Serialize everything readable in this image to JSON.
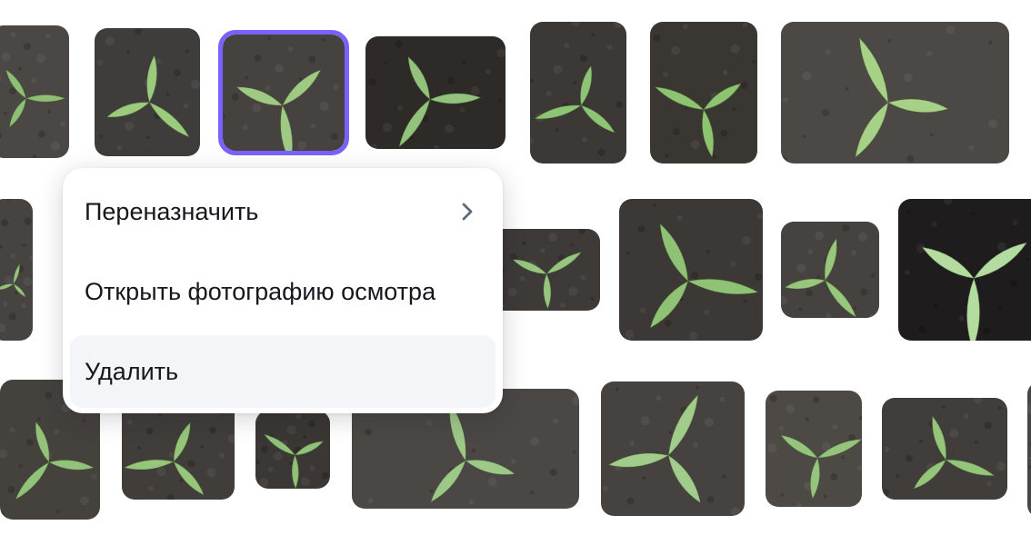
{
  "thumbnails": [
    {
      "name": "seedling-photo",
      "bg": "#4a4744",
      "leaf": "#8fbf74",
      "selected": false
    },
    {
      "name": "seedling-photo",
      "bg": "#3f3d3b",
      "leaf": "#9ccb7d",
      "selected": false
    },
    {
      "name": "seedling-photo",
      "bg": "#46423f",
      "leaf": "#a0c983",
      "selected": true
    },
    {
      "name": "seedling-photo",
      "bg": "#2e2a27",
      "leaf": "#92c27b",
      "selected": false
    },
    {
      "name": "seedling-photo",
      "bg": "#3b3836",
      "leaf": "#8ec476",
      "selected": false
    },
    {
      "name": "seedling-photo",
      "bg": "#3a3733",
      "leaf": "#8cc470",
      "selected": false
    },
    {
      "name": "seedling-photo",
      "bg": "#4c4845",
      "leaf": "#a6d187",
      "selected": false
    },
    {
      "name": "seedling-photo",
      "bg": "#464341",
      "leaf": "#96c27e",
      "selected": false
    },
    {
      "name": "seedling-photo",
      "bg": "#3d3a37",
      "leaf": "#97c47f",
      "selected": false
    },
    {
      "name": "seedling-photo",
      "bg": "#3b3835",
      "leaf": "#8fc275",
      "selected": false
    },
    {
      "name": "seedling-photo",
      "bg": "#46423f",
      "leaf": "#98c67d",
      "selected": false
    },
    {
      "name": "seedling-photo",
      "bg": "#1e1c1d",
      "leaf": "#b4dba0",
      "selected": false
    },
    {
      "name": "seedling-photo",
      "bg": "#45413d",
      "leaf": "#93c27a",
      "selected": false
    },
    {
      "name": "seedling-photo",
      "bg": "#403d3a",
      "leaf": "#95c67a",
      "selected": false
    },
    {
      "name": "seedling-photo",
      "bg": "#3a3734",
      "leaf": "#8fc176",
      "selected": false
    },
    {
      "name": "seedling-photo",
      "bg": "#4a4744",
      "leaf": "#9ec887",
      "selected": false
    },
    {
      "name": "seedling-photo",
      "bg": "#46423f",
      "leaf": "#a2cc8b",
      "selected": false
    },
    {
      "name": "seedling-photo",
      "bg": "#4d4945",
      "leaf": "#96c37d",
      "selected": false
    },
    {
      "name": "seedling-photo",
      "bg": "#403d3a",
      "leaf": "#94c57b",
      "selected": false
    },
    {
      "name": "seedling-photo",
      "bg": "#484542",
      "leaf": "#9bc985",
      "selected": false
    }
  ],
  "context_menu": {
    "items": [
      {
        "label": "Переназначить",
        "has_submenu": true,
        "highlighted": false
      },
      {
        "label": "Открыть фотографию осмотра",
        "has_submenu": false,
        "highlighted": false
      },
      {
        "label": "Удалить",
        "has_submenu": false,
        "highlighted": true
      }
    ]
  },
  "colors": {
    "selection_outline": "#7b61ff",
    "menu_highlight": "#f4f5f9",
    "chevron": "#5f6b7c"
  }
}
